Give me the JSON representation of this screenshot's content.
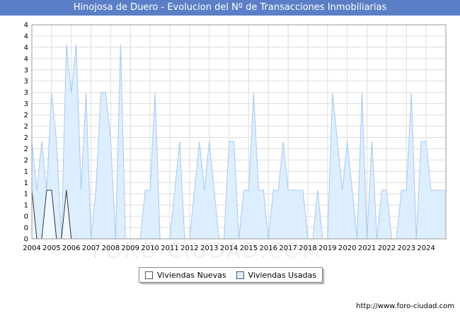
{
  "chart_data": {
    "type": "area",
    "title": "Hinojosa de Duero - Evolucion del Nº de Transacciones Inmobiliarias",
    "source": "http://www.foro-ciudad.com",
    "watermark": "FORO-CIUDAD.COM",
    "x_ticks": [
      "2004",
      "2005",
      "2006",
      "2007",
      "2008",
      "2009",
      "2010",
      "2011",
      "2012",
      "2013",
      "2014",
      "2015",
      "2016",
      "2017",
      "2018",
      "2019",
      "2020",
      "2021",
      "2022",
      "2023",
      "2024"
    ],
    "y_ticks": [
      "0",
      "0",
      "0",
      "1",
      "1",
      "1",
      "1",
      "2",
      "2",
      "2",
      "2",
      "2",
      "3",
      "3",
      "3",
      "3",
      "4",
      "4",
      "4",
      "4"
    ],
    "y_range": [
      0,
      4.4
    ],
    "x_range": [
      2004,
      2025
    ],
    "grid": true,
    "legend_position": "bottom",
    "series": [
      {
        "name": "Viviendas Nuevas",
        "color": "#ffffff",
        "points": [
          [
            2004.0,
            1
          ],
          [
            2004.25,
            0
          ],
          [
            2004.5,
            0
          ],
          [
            2004.75,
            1
          ],
          [
            2005.0,
            1
          ],
          [
            2005.25,
            0
          ],
          [
            2005.5,
            0
          ],
          [
            2005.75,
            1
          ],
          [
            2006.0,
            0
          ],
          [
            2025.0,
            0
          ]
        ]
      },
      {
        "name": "Viviendas Usadas",
        "color": "#ddeeff",
        "points": [
          [
            2004.0,
            2
          ],
          [
            2004.25,
            1
          ],
          [
            2004.5,
            2
          ],
          [
            2004.75,
            1
          ],
          [
            2005.0,
            3
          ],
          [
            2005.25,
            2
          ],
          [
            2005.5,
            0
          ],
          [
            2005.75,
            4
          ],
          [
            2006.0,
            3
          ],
          [
            2006.25,
            4
          ],
          [
            2006.5,
            1
          ],
          [
            2006.75,
            3
          ],
          [
            2007.0,
            0
          ],
          [
            2007.25,
            1
          ],
          [
            2007.5,
            3
          ],
          [
            2007.75,
            3
          ],
          [
            2008.0,
            2
          ],
          [
            2008.25,
            0
          ],
          [
            2008.5,
            4
          ],
          [
            2008.75,
            0
          ],
          [
            2009.0,
            0
          ],
          [
            2009.25,
            0
          ],
          [
            2009.5,
            0
          ],
          [
            2009.75,
            1
          ],
          [
            2010.0,
            1
          ],
          [
            2010.25,
            3
          ],
          [
            2010.5,
            0
          ],
          [
            2010.75,
            0
          ],
          [
            2011.0,
            0
          ],
          [
            2011.25,
            1
          ],
          [
            2011.5,
            2
          ],
          [
            2011.75,
            0
          ],
          [
            2012.0,
            0
          ],
          [
            2012.25,
            1
          ],
          [
            2012.5,
            2
          ],
          [
            2012.75,
            1
          ],
          [
            2013.0,
            2
          ],
          [
            2013.25,
            1
          ],
          [
            2013.5,
            0
          ],
          [
            2013.75,
            0
          ],
          [
            2014.0,
            2
          ],
          [
            2014.25,
            2
          ],
          [
            2014.5,
            0
          ],
          [
            2014.75,
            1
          ],
          [
            2015.0,
            1
          ],
          [
            2015.25,
            3
          ],
          [
            2015.5,
            1
          ],
          [
            2015.75,
            1
          ],
          [
            2016.0,
            0
          ],
          [
            2016.25,
            1
          ],
          [
            2016.5,
            1
          ],
          [
            2016.75,
            2
          ],
          [
            2017.0,
            1
          ],
          [
            2017.25,
            1
          ],
          [
            2017.5,
            1
          ],
          [
            2017.75,
            1
          ],
          [
            2018.0,
            0
          ],
          [
            2018.25,
            0
          ],
          [
            2018.5,
            1
          ],
          [
            2018.75,
            0
          ],
          [
            2019.0,
            0
          ],
          [
            2019.25,
            3
          ],
          [
            2019.5,
            2
          ],
          [
            2019.75,
            1
          ],
          [
            2020.0,
            2
          ],
          [
            2020.25,
            1
          ],
          [
            2020.5,
            0
          ],
          [
            2020.75,
            3
          ],
          [
            2021.0,
            0
          ],
          [
            2021.25,
            2
          ],
          [
            2021.5,
            0
          ],
          [
            2021.75,
            1
          ],
          [
            2022.0,
            1
          ],
          [
            2022.25,
            0
          ],
          [
            2022.5,
            0
          ],
          [
            2022.75,
            1
          ],
          [
            2023.0,
            1
          ],
          [
            2023.25,
            3
          ],
          [
            2023.5,
            0
          ],
          [
            2023.75,
            2
          ],
          [
            2024.0,
            2
          ],
          [
            2024.25,
            1
          ],
          [
            2024.5,
            1
          ],
          [
            2024.75,
            1
          ],
          [
            2025.0,
            1
          ]
        ]
      }
    ]
  }
}
